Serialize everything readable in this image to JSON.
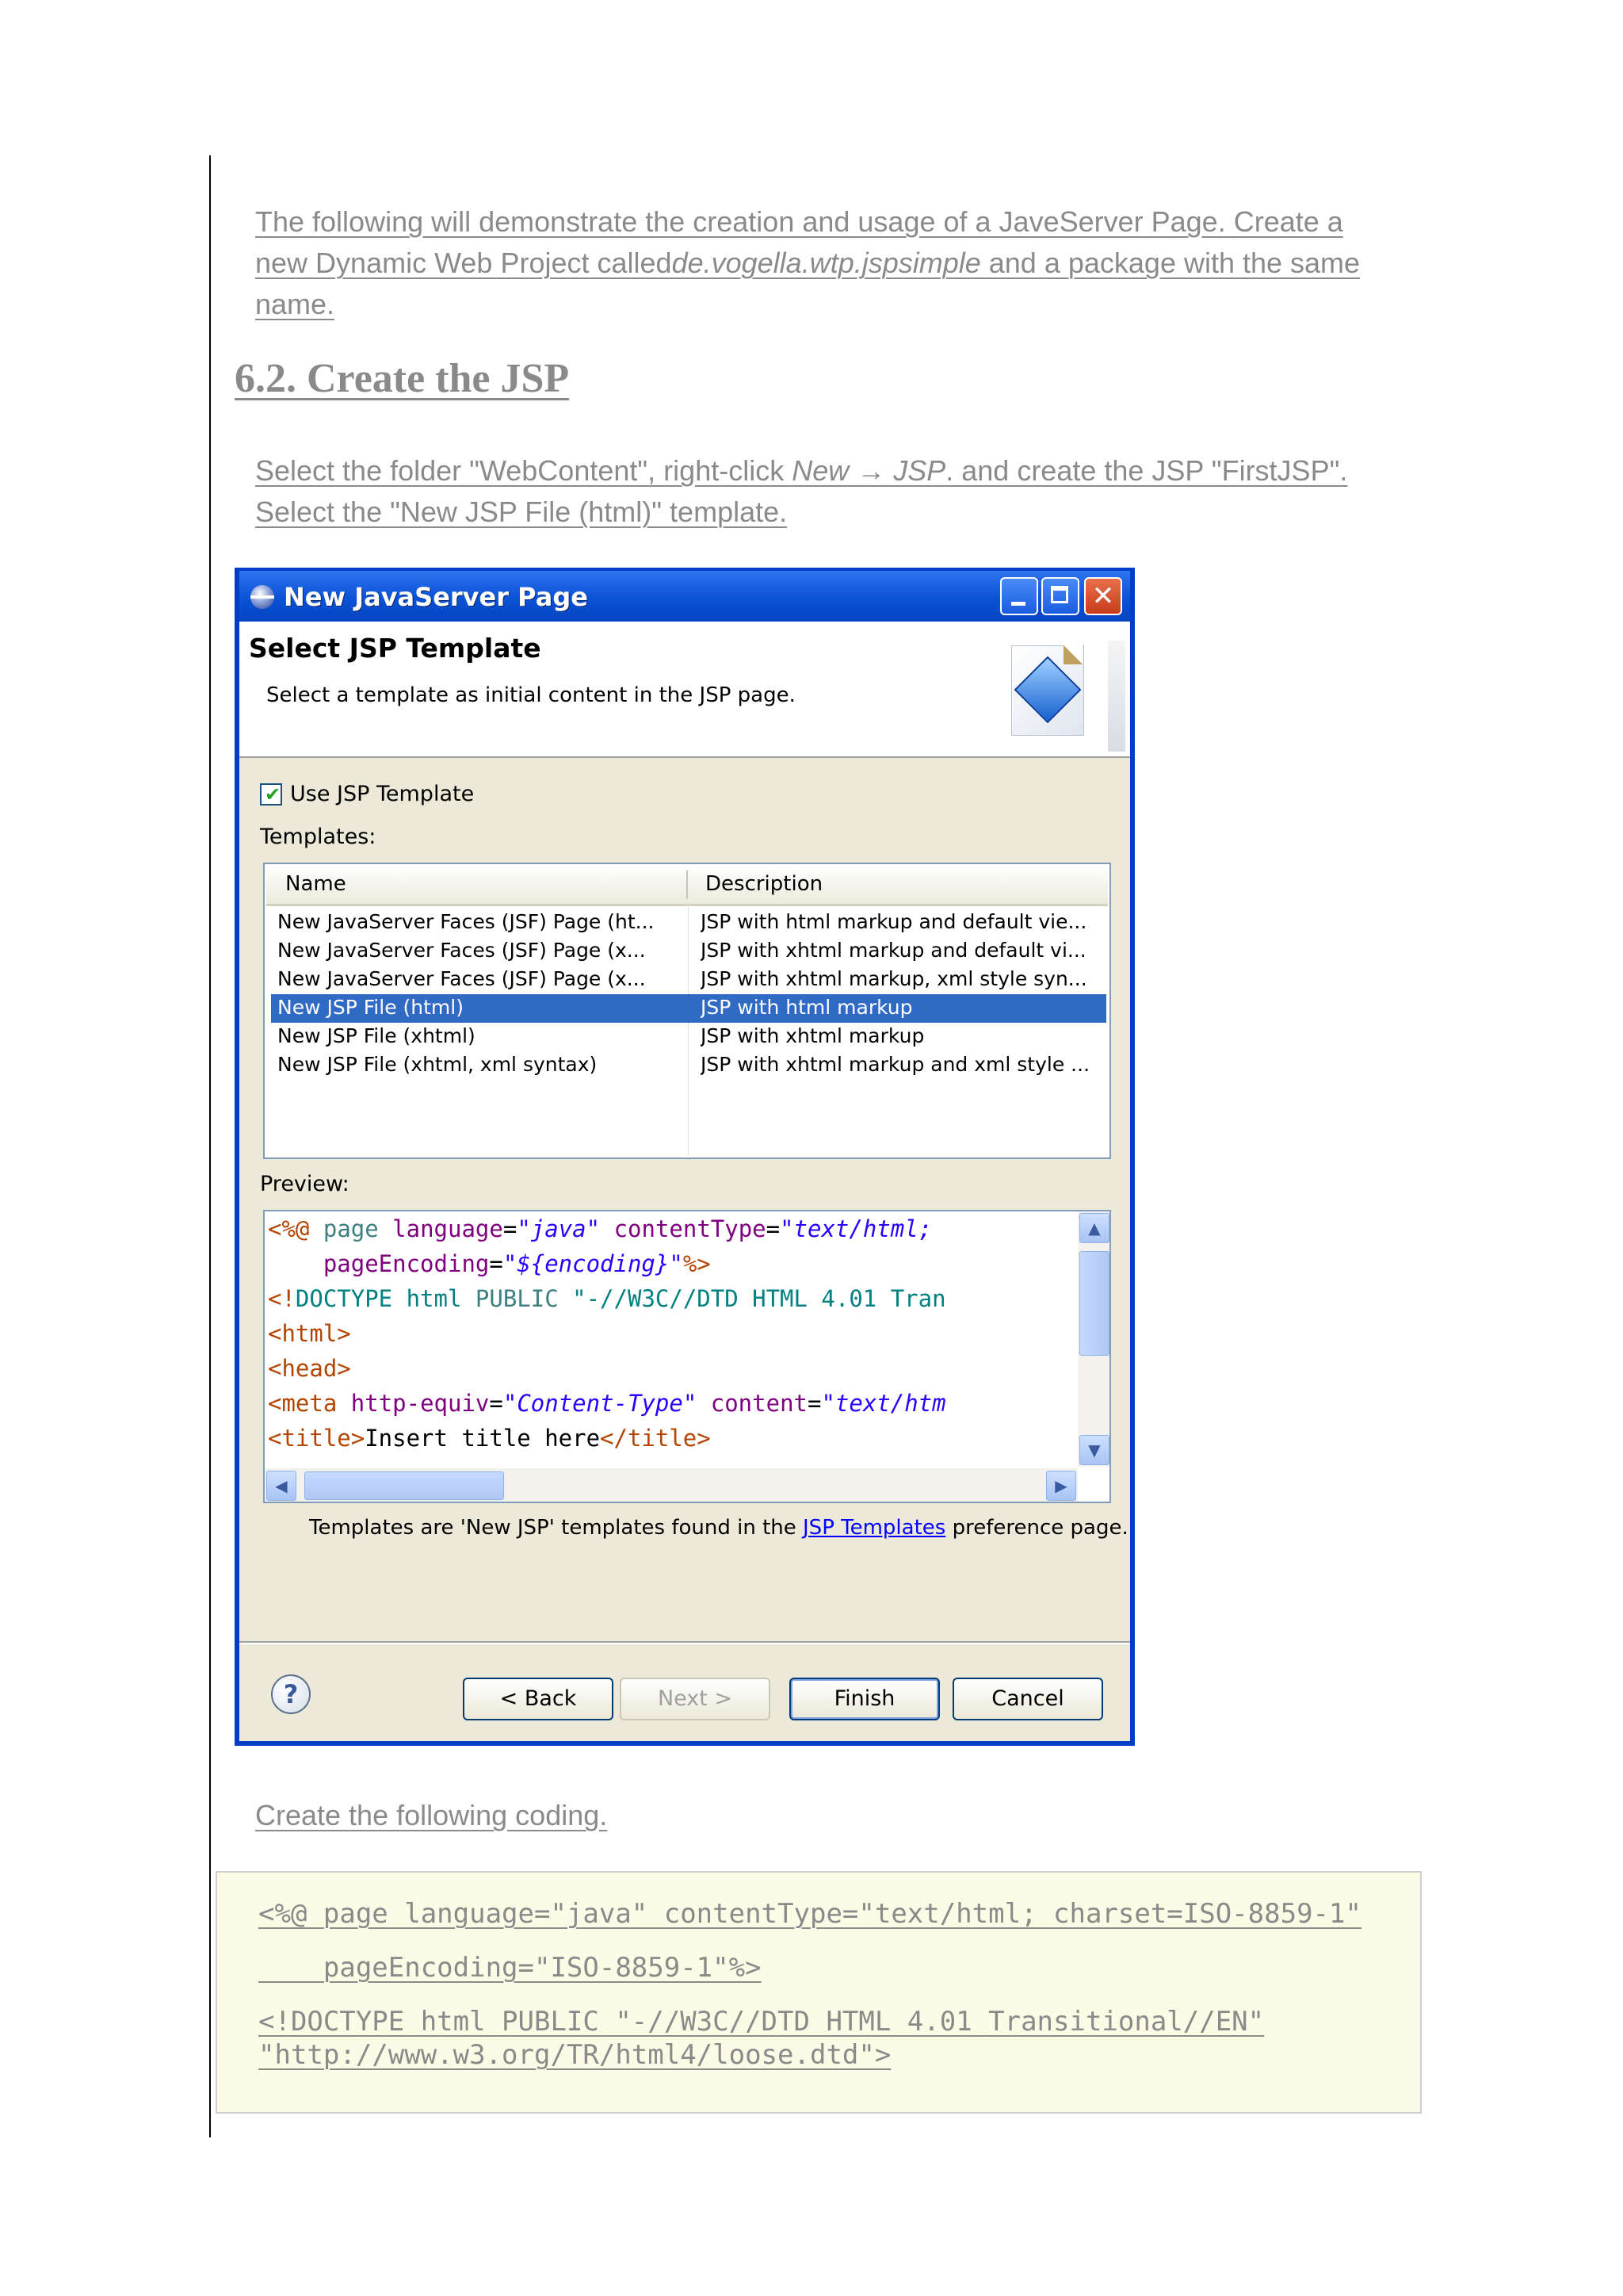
{
  "intro": {
    "line1": "The following will demonstrate the creation and usage of a JaveServer Page. Create a",
    "line2_pre": "new Dynamic Web Project called",
    "line2_em": "de.vogella.wtp.jspsimple",
    "line2_post": " and a package with the same",
    "line3": "name."
  },
  "section_heading": "6.2. Create the JSP",
  "instruction": {
    "line1_pre": "Select the folder \"WebContent\", right-click ",
    "line1_em": "New → JSP",
    "line1_post": ". and create the JSP \"FirstJSP\".",
    "line2": "Select the \"New JSP File (html)\" template."
  },
  "dialog": {
    "title": "New JavaServer Page",
    "header_title": "Select JSP Template",
    "header_desc": "Select a template as initial content in the JSP page.",
    "use_template_label": "Use JSP Template",
    "use_template_checked": true,
    "templates_label": "Templates:",
    "columns": [
      "Name",
      "Description"
    ],
    "rows": [
      {
        "name": "New JavaServer Faces (JSF) Page (ht...",
        "desc": "JSP with html markup and default vie..."
      },
      {
        "name": "New JavaServer Faces (JSF) Page (x...",
        "desc": "JSP with xhtml markup and default vi..."
      },
      {
        "name": "New JavaServer Faces (JSF) Page (x...",
        "desc": "JSP with xhtml markup, xml style syn..."
      },
      {
        "name": "New JSP File (html)",
        "desc": "JSP with html markup"
      },
      {
        "name": "New JSP File (xhtml)",
        "desc": "JSP with xhtml markup"
      },
      {
        "name": "New JSP File (xhtml, xml syntax)",
        "desc": "JSP with xhtml markup and xml style ..."
      }
    ],
    "selected_row": 3,
    "preview_label": "Preview:",
    "preview_lines": [
      "<%@ page language=\"java\" contentType=\"text/html;",
      "    pageEncoding=\"${encoding}\"%>",
      "<!DOCTYPE html PUBLIC \"-//W3C//DTD HTML 4.01 Tran",
      "<html>",
      "<head>",
      "<meta http-equiv=\"Content-Type\" content=\"text/htm",
      "<title>Insert title here</title>"
    ],
    "note_pre": "Templates are 'New JSP' templates found in the ",
    "note_link": "JSP Templates",
    "note_post": " preference page.",
    "buttons": {
      "back": "< Back",
      "next": "Next >",
      "finish": "Finish",
      "cancel": "Cancel"
    },
    "help_glyph": "?"
  },
  "create_text": "Create the following coding.",
  "code_lines": [
    "<%@ page language=\"java\" contentType=\"text/html; charset=ISO-8859-1\"",
    "    pageEncoding=\"ISO-8859-1\"%>",
    "<!DOCTYPE html PUBLIC \"-//W3C//DTD HTML 4.01 Transitional//EN\"",
    "\"http://www.w3.org/TR/html4/loose.dtd\">"
  ],
  "colors": {
    "text_gray": "#8a8a8a",
    "xp_titlebar": "#0a52d6",
    "selection": "#316ac5",
    "code_bg": "#fbfbe6"
  },
  "icons": [
    "eclipse-icon",
    "minimize-icon",
    "maximize-icon",
    "close-icon",
    "wizard-banner-icon",
    "checkbox-check-icon",
    "help-icon",
    "scroll-up-icon",
    "scroll-down-icon",
    "scroll-left-icon",
    "scroll-right-icon"
  ]
}
